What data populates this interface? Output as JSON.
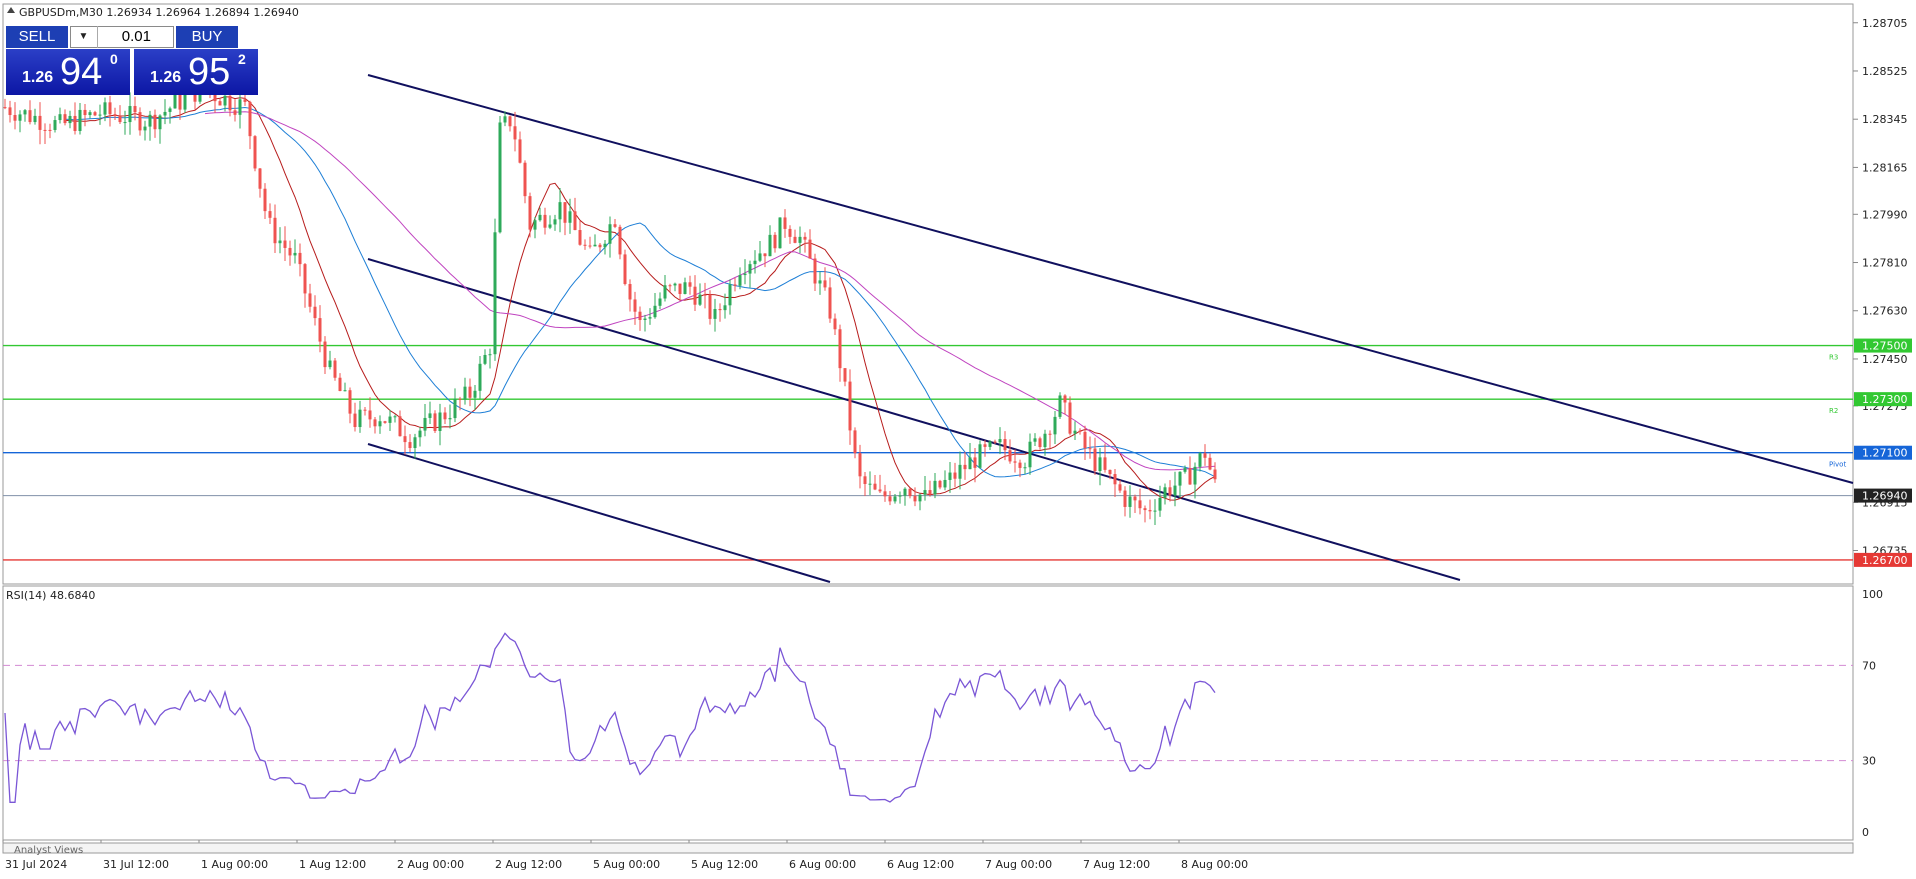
{
  "header": {
    "symbol_info": "GBPUSDm,M30  1.26934 1.26964 1.26894 1.26940",
    "symbol_icon": "triangle-up-icon"
  },
  "trade_panel": {
    "sell_label": "SELL",
    "buy_label": "BUY",
    "volume": "0.01",
    "sell_prefix": "1.26",
    "sell_big": "94",
    "sell_sup": "0",
    "buy_prefix": "1.26",
    "buy_big": "95",
    "buy_sup": "2"
  },
  "price_axis": {
    "ticks": [
      "1.28705",
      "1.28525",
      "1.28345",
      "1.28165",
      "1.27990",
      "1.27810",
      "1.27630",
      "1.27450",
      "1.27275",
      "1.26915",
      "1.26735"
    ],
    "min": 1.2661,
    "max": 1.28775
  },
  "levels": [
    {
      "label": "1.27500",
      "value": 1.275,
      "color": "#32c832",
      "small": "R3"
    },
    {
      "label": "1.27300",
      "value": 1.273,
      "color": "#32c832",
      "small": "R2"
    },
    {
      "label": "1.27100",
      "value": 1.271,
      "color": "#1565d8",
      "small": "Pivot"
    },
    {
      "label": "1.26700",
      "value": 1.267,
      "color": "#e53935",
      "small": ""
    }
  ],
  "current_price": {
    "label": "1.26940",
    "value": 1.2694,
    "color": "#222222"
  },
  "rsi": {
    "title": "RSI(14) 48.6840",
    "axis_labels": [
      "100",
      "70",
      "30",
      "0"
    ],
    "overbought": 70,
    "oversold": 30,
    "series_color": "#7a56d6"
  },
  "time_axis": {
    "labels": [
      "31 Jul 2024",
      "31 Jul 12:00",
      "1 Aug 00:00",
      "1 Aug 12:00",
      "2 Aug 00:00",
      "2 Aug 12:00",
      "5 Aug 00:00",
      "5 Aug 12:00",
      "6 Aug 00:00",
      "6 Aug 12:00",
      "7 Aug 00:00",
      "7 Aug 12:00",
      "8 Aug 00:00"
    ]
  },
  "bottom_tab": "Analyst Views",
  "colors": {
    "bull": "#2eaa5a",
    "bear": "#ef5350",
    "ma_fast": "#b71c1c",
    "ma_mid": "#1e7fd6",
    "ma_slow": "#c044c0",
    "channel": "#10105e"
  }
}
